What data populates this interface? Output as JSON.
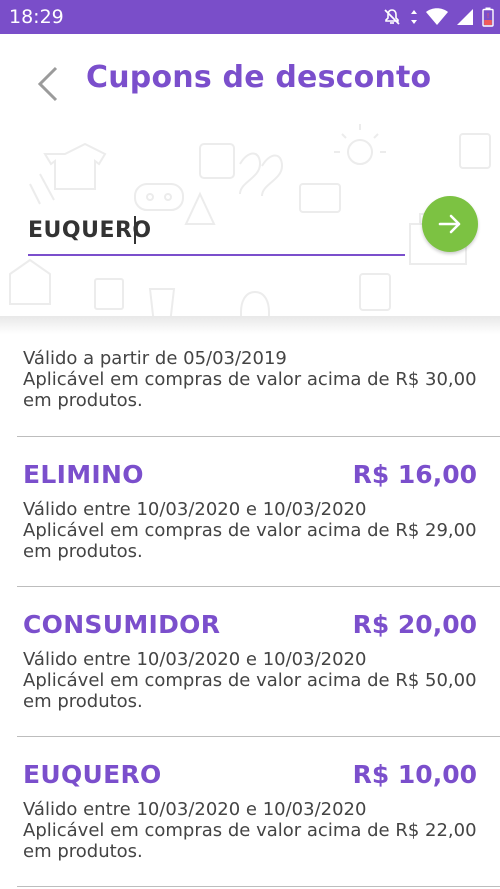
{
  "status_bar": {
    "time": "18:29",
    "icons": [
      "mute-icon",
      "data-arrows-icon",
      "wifi-icon",
      "signal-icon",
      "battery-icon"
    ]
  },
  "header": {
    "title": "Cupons de desconto",
    "coupon_input_value": "EUQUERO",
    "colors": {
      "primary": "#7b4fcc",
      "status_bar": "#7a4ec9",
      "submit": "#7cc242"
    }
  },
  "partial_coupon": {
    "validity": "Válido a partir de 05/03/2019",
    "condition_line1": "Aplicável em compras de valor acima de R$ 30,00",
    "condition_line2": "em produtos."
  },
  "coupons": [
    {
      "code": "ELIMINO",
      "amount": "R$ 16,00",
      "validity": "Válido entre 10/03/2020 e 10/03/2020",
      "condition_line1": "Aplicável em compras de valor acima de R$ 29,00",
      "condition_line2": "em produtos."
    },
    {
      "code": "CONSUMIDOR",
      "amount": "R$ 20,00",
      "validity": "Válido entre 10/03/2020 e 10/03/2020",
      "condition_line1": "Aplicável em compras de valor acima de R$ 50,00",
      "condition_line2": "em produtos."
    },
    {
      "code": "EUQUERO",
      "amount": "R$ 10,00",
      "validity": "Válido entre 10/03/2020 e 10/03/2020",
      "condition_line1": "Aplicável em compras de valor acima de R$ 22,00",
      "condition_line2": "em produtos."
    }
  ]
}
